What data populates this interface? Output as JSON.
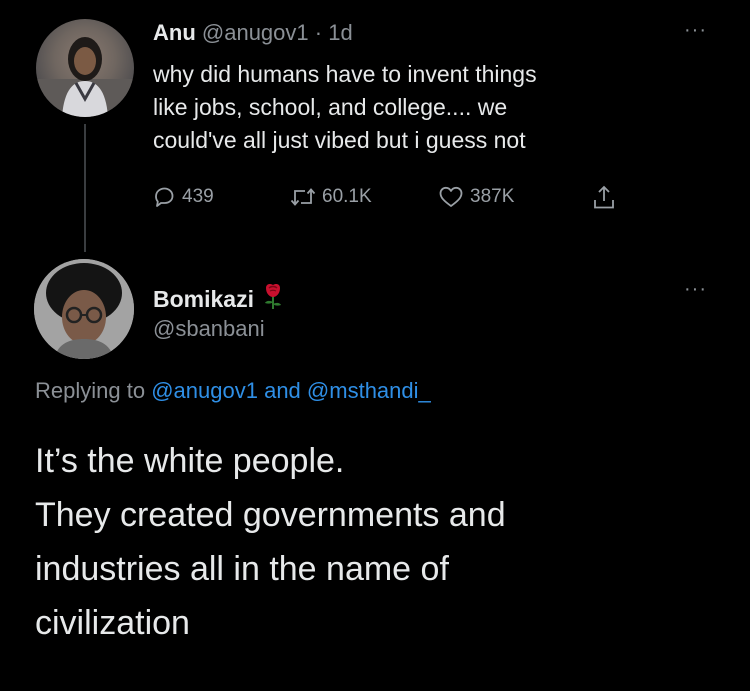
{
  "tweet1": {
    "name": "Anu",
    "handle": "@anugov1",
    "separator": "·",
    "time": "1d",
    "lines": [
      "why did humans have to invent things",
      "like jobs, school, and college.... we",
      "could've all just vibed but i guess not"
    ],
    "more": "···",
    "replies": "439",
    "retweets": "60.1K",
    "likes": "387K"
  },
  "tweet2": {
    "name": "Bomikazi",
    "emoji": "🌹",
    "handle": "@sbanbani",
    "more": "···",
    "replying_prefix": "Replying to",
    "replying_user1": "@anugov1",
    "replying_and": "and",
    "replying_user2": "@msthandi_",
    "lines": [
      "It’s the white people.",
      "They created governments and",
      "industries all in the name of",
      "civilization"
    ]
  },
  "colors": {
    "background": "#000000",
    "text": "#e7e9ea",
    "muted": "#8b9096",
    "link": "#2f8fe6"
  },
  "icons": [
    "reply-icon",
    "retweet-icon",
    "like-icon",
    "share-icon",
    "more-icon",
    "rose-icon"
  ]
}
